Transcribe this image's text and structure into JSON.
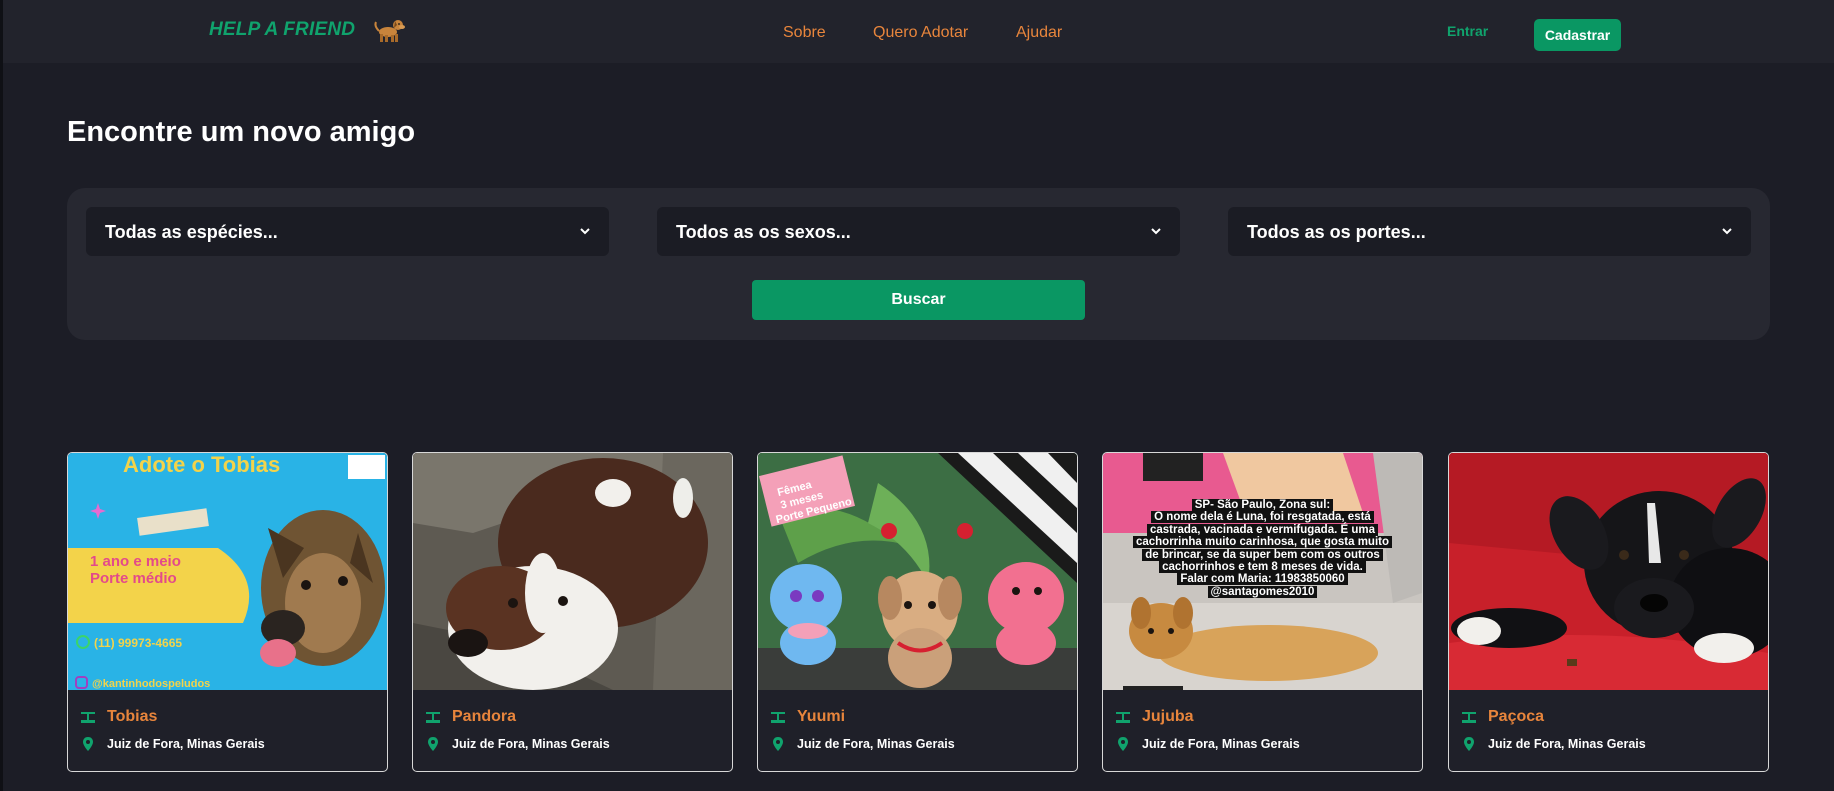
{
  "header": {
    "logo_text": "HELP A FRIEND",
    "logo_icon": "dog-icon",
    "nav": [
      {
        "label": "Sobre"
      },
      {
        "label": "Quero Adotar"
      },
      {
        "label": "Ajudar"
      }
    ],
    "login_label": "Entrar",
    "signup_label": "Cadastrar"
  },
  "main": {
    "title": "Encontre um novo amigo",
    "filters": {
      "species": "Todas as espécies...",
      "sex": "Todos as os sexos...",
      "size": "Todos as os portes..."
    },
    "search_label": "Buscar"
  },
  "cards": [
    {
      "name": "Tobias",
      "location": "Juiz de Fora, Minas Gerais",
      "photo_text": {
        "headline": "Adote o Tobias",
        "age": "1 ano e meio",
        "size": "Porte médio",
        "phone": "(11) 99973-4665",
        "instagram": "@kantinhodospeludos"
      }
    },
    {
      "name": "Pandora",
      "location": "Juiz de Fora, Minas Gerais"
    },
    {
      "name": "Yuumi",
      "location": "Juiz de Fora, Minas Gerais",
      "photo_text": {
        "line1": "Fêmea",
        "line2": "3 meses",
        "line3": "Porte Pequeno"
      }
    },
    {
      "name": "Jujuba",
      "location": "Juiz de Fora, Minas Gerais",
      "photo_text": {
        "lines": [
          "SP- São Paulo, Zona sul:",
          "O nome dela é Luna, foi resgatada, está",
          "castrada, vacinada e vermifugada. É uma",
          "cachorrinha muito carinhosa, que gosta muito",
          "de brincar, se da super bem com os outros",
          "cachorrinhos e tem 8 meses de vida.",
          "Falar com Maria: 11983850060",
          "@santagomes2010"
        ]
      }
    },
    {
      "name": "Paçoca",
      "location": "Juiz de Fora, Minas Gerais"
    }
  ],
  "colors": {
    "background": "#1c1d26",
    "header": "#22232c",
    "accent_green": "#0a9763",
    "accent_orange": "#e8853c",
    "panel": "#272831"
  },
  "icons": {
    "card_name": "scale-icon",
    "card_location": "map-pin-icon",
    "select": "chevron-down-icon"
  }
}
